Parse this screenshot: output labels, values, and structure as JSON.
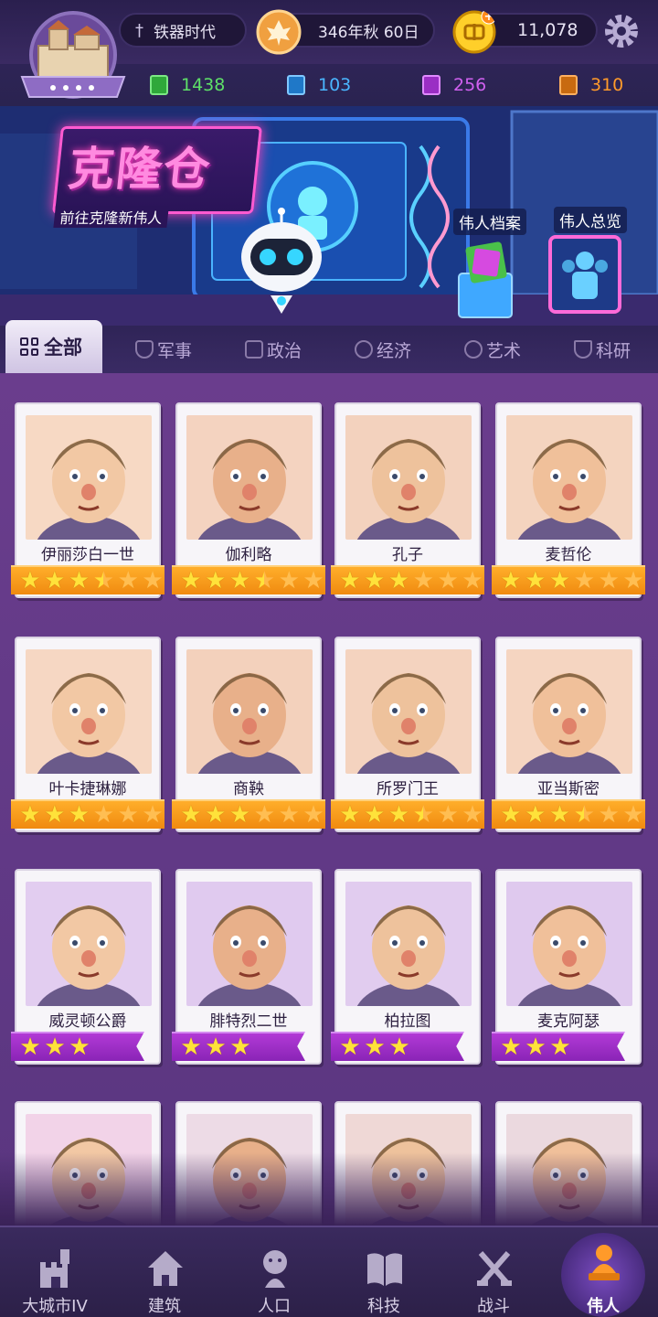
{
  "topbar": {
    "era": "铁器时代",
    "date": "346年秋 60日",
    "gold": "11,078"
  },
  "resources": [
    {
      "value": "1438",
      "color": "#3ed04a"
    },
    {
      "value": "103",
      "color": "#3aa8f0"
    },
    {
      "value": "256",
      "color": "#c04ae0"
    },
    {
      "value": "310",
      "color": "#f08a1a"
    }
  ],
  "banner": {
    "title": "克隆仓",
    "subtitle": "前往克隆新伟人",
    "archive_label": "伟人档案",
    "overview_label": "伟人总览"
  },
  "tabs": {
    "all": "全部",
    "military": "军事",
    "politics": "政治",
    "economy": "经济",
    "art": "艺术",
    "research": "科研"
  },
  "heroes": [
    {
      "name": "伊丽莎白一世",
      "stars": 3.5,
      "ribbon": "orange",
      "bg": "#f7d9c4"
    },
    {
      "name": "伽利略",
      "stars": 3.5,
      "ribbon": "orange",
      "bg": "#f4d3c0"
    },
    {
      "name": "孔子",
      "stars": 3,
      "ribbon": "orange",
      "bg": "#f3d2be"
    },
    {
      "name": "麦哲伦",
      "stars": 3,
      "ribbon": "orange",
      "bg": "#f4d4bf"
    },
    {
      "name": "叶卡捷琳娜",
      "stars": 3,
      "ribbon": "orange",
      "bg": "#f6d7c3"
    },
    {
      "name": "商鞅",
      "stars": 3,
      "ribbon": "orange",
      "bg": "#f3d1bc"
    },
    {
      "name": "所罗门王",
      "stars": 3.5,
      "ribbon": "orange",
      "bg": "#f4d3bf"
    },
    {
      "name": "亚当斯密",
      "stars": 3.5,
      "ribbon": "orange",
      "bg": "#f5d5c1"
    },
    {
      "name": "威灵顿公爵",
      "stars": 3,
      "ribbon": "purple",
      "bg": "#e2cdf0"
    },
    {
      "name": "腓特烈二世",
      "stars": 3,
      "ribbon": "purple",
      "bg": "#e0caef"
    },
    {
      "name": "柏拉图",
      "stars": 3,
      "ribbon": "purple",
      "bg": "#e1ccef"
    },
    {
      "name": "麦克阿瑟",
      "stars": 3,
      "ribbon": "purple",
      "bg": "#dfc9ee"
    },
    {
      "name": "",
      "stars": 0,
      "ribbon": "none",
      "bg": "#f2d3e8"
    },
    {
      "name": "",
      "stars": 0,
      "ribbon": "none",
      "bg": "#eddbe6"
    },
    {
      "name": "",
      "stars": 0,
      "ribbon": "none",
      "bg": "#efd8d6"
    },
    {
      "name": "",
      "stars": 0,
      "ribbon": "none",
      "bg": "#ebd9df"
    }
  ],
  "nav": [
    {
      "label": "大城市IV",
      "icon": "castle-icon"
    },
    {
      "label": "建筑",
      "icon": "house-icon"
    },
    {
      "label": "人口",
      "icon": "person-icon"
    },
    {
      "label": "科技",
      "icon": "book-icon"
    },
    {
      "label": "战斗",
      "icon": "swords-icon"
    },
    {
      "label": "伟人",
      "icon": "bust-icon",
      "active": true
    }
  ]
}
